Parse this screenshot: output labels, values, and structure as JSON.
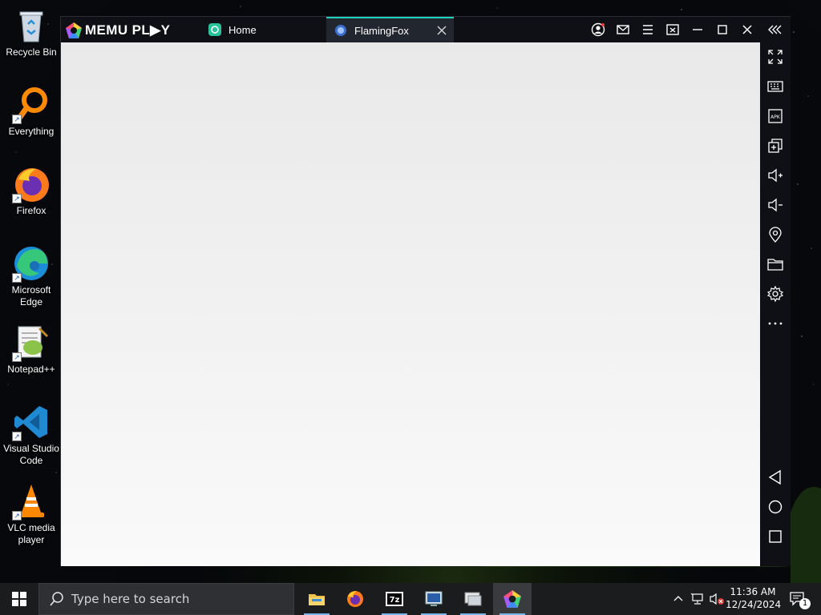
{
  "desktop": {
    "icons": [
      {
        "label": "Recycle Bin",
        "icon": "recycle-bin-icon"
      },
      {
        "label": "Everything",
        "icon": "everything-search-icon"
      },
      {
        "label": "Firefox",
        "icon": "firefox-icon"
      },
      {
        "label": "Microsoft Edge",
        "icon": "edge-icon"
      },
      {
        "label": "Notepad++",
        "icon": "notepad-plus-plus-icon"
      },
      {
        "label": "Visual Studio Code",
        "icon": "vscode-icon"
      },
      {
        "label": "VLC media player",
        "icon": "vlc-icon"
      }
    ]
  },
  "memu": {
    "logo_text": "MEMU PL▶Y",
    "tabs": [
      {
        "label": "Home",
        "icon": "home-tab-icon",
        "active": false
      },
      {
        "label": "FlamingFox",
        "icon": "flamingfox-tab-icon",
        "active": true
      }
    ],
    "title_buttons": [
      "account-icon",
      "mail-icon",
      "menu-icon",
      "screen-mode-icon",
      "minimize-icon",
      "maximize-icon",
      "close-icon",
      "collapse-sidebar-icon"
    ],
    "sidebar_buttons": [
      "fullscreen-icon",
      "keyboard-mapping-icon",
      "apk-install-icon",
      "multi-instance-icon",
      "volume-up-icon",
      "volume-down-icon",
      "location-icon",
      "shared-folder-icon",
      "settings-icon",
      "more-icon"
    ],
    "nav_buttons": [
      "back-icon",
      "home-icon",
      "recent-apps-icon"
    ]
  },
  "taskbar": {
    "search_placeholder": "Type here to search",
    "apps": [
      "file-explorer-icon",
      "firefox-icon",
      "7zip-icon",
      "terminal-app-icon",
      "remote-desktop-icon",
      "memu-icon"
    ],
    "clock_time": "11:36 AM",
    "clock_date": "12/24/2024",
    "notification_count": "1"
  },
  "colors": {
    "accent_tab": "#1fd1bd",
    "window_bg": "#0e1016",
    "taskbar_bg": "#1b1c1e"
  }
}
